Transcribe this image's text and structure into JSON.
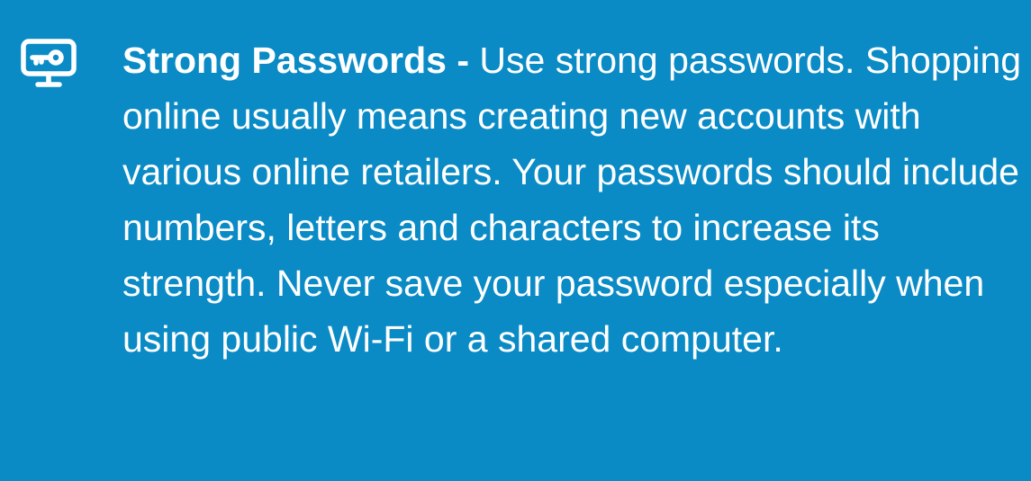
{
  "tip": {
    "icon": "monitor-key-icon",
    "title": "Strong Passwords -",
    "body": "Use strong passwords.  Shopping online usually means creating new accounts with various online retailers. Your passwords should include numbers, letters and characters to increase its strength. Never save your password especially when using public Wi-Fi or a shared computer."
  },
  "colors": {
    "background": "#0a8bc6",
    "text": "#ffffff"
  }
}
